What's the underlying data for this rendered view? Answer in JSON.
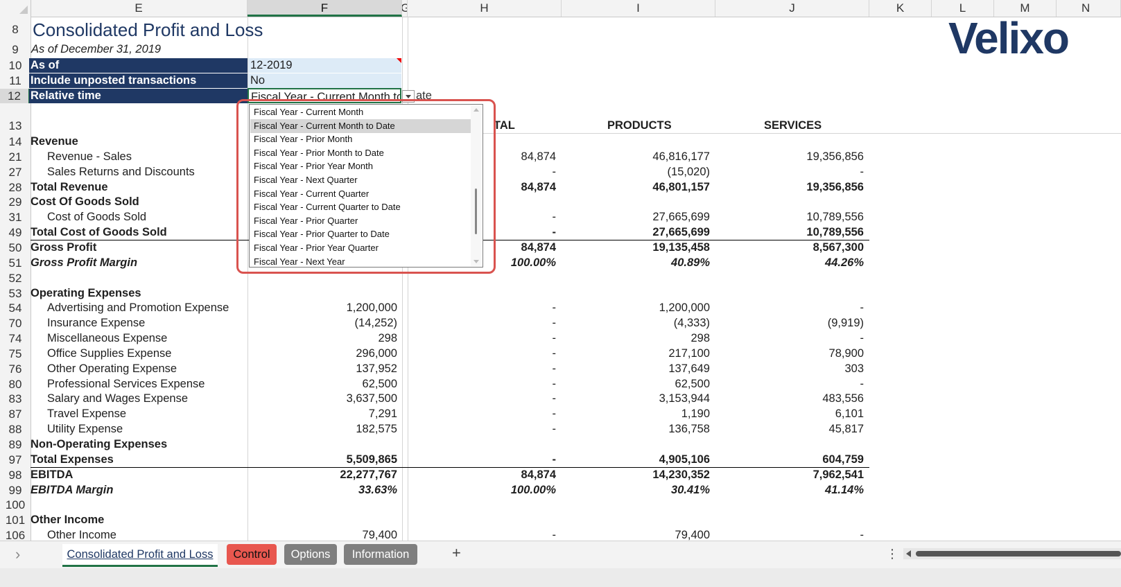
{
  "columns": [
    "E",
    "F",
    "G",
    "H",
    "I",
    "J",
    "K",
    "L",
    "M",
    "N"
  ],
  "report": {
    "title": "Consolidated Profit and Loss",
    "subtitle": "As of December 31, 2019"
  },
  "params": [
    {
      "row": "10",
      "label": "As of",
      "value": "12-2019"
    },
    {
      "row": "11",
      "label": "Include unposted transactions",
      "value": "No"
    },
    {
      "row": "12",
      "label": "Relative time",
      "value": "Fiscal Year - Current Month to Date"
    }
  ],
  "param_overflow": "ate",
  "logo": "Velixo",
  "headers": {
    "row": "13",
    "h": "TAL",
    "i": "PRODUCTS",
    "j": "SERVICES"
  },
  "rows": [
    {
      "n": "14",
      "label": "Revenue",
      "style": "b",
      "indent": false,
      "f": "",
      "h": "",
      "i": "",
      "j": ""
    },
    {
      "n": "21",
      "label": "Revenue - Sales",
      "style": "",
      "indent": true,
      "f": "",
      "h": "84,874",
      "i": "46,816,177",
      "j": "19,356,856"
    },
    {
      "n": "27",
      "label": "Sales Returns and Discounts",
      "style": "",
      "indent": true,
      "f": "",
      "h": "-",
      "i": "(15,020)",
      "j": "-"
    },
    {
      "n": "28",
      "label": "Total Revenue",
      "style": "b",
      "indent": false,
      "f": "",
      "h": "84,874",
      "i": "46,801,157",
      "j": "19,356,856"
    },
    {
      "n": "29",
      "label": "Cost Of Goods Sold",
      "style": "b",
      "indent": false,
      "f": "",
      "h": "",
      "i": "",
      "j": ""
    },
    {
      "n": "31",
      "label": "Cost of Goods Sold",
      "style": "",
      "indent": true,
      "f": "",
      "h": "-",
      "i": "27,665,699",
      "j": "10,789,556"
    },
    {
      "n": "49",
      "label": "Total Cost of Goods Sold",
      "style": "b",
      "indent": false,
      "f": "",
      "h": "-",
      "i": "27,665,699",
      "j": "10,789,556"
    },
    {
      "n": "50",
      "label": "Gross Profit",
      "style": "b",
      "indent": false,
      "f": "",
      "h": "84,874",
      "i": "19,135,458",
      "j": "8,567,300"
    },
    {
      "n": "51",
      "label": "Gross Profit Margin",
      "style": "bi",
      "indent": false,
      "f": "",
      "h": "100.00%",
      "i": "40.89%",
      "j": "44.26%"
    },
    {
      "n": "52",
      "label": "",
      "style": "",
      "indent": false,
      "f": "",
      "h": "",
      "i": "",
      "j": ""
    },
    {
      "n": "53",
      "label": "Operating Expenses",
      "style": "b",
      "indent": false,
      "f": "",
      "h": "",
      "i": "",
      "j": ""
    },
    {
      "n": "54",
      "label": "Advertising and Promotion Expense",
      "style": "",
      "indent": true,
      "f": "1,200,000",
      "h": "-",
      "i": "1,200,000",
      "j": "-"
    },
    {
      "n": "70",
      "label": "Insurance Expense",
      "style": "",
      "indent": true,
      "f": "(14,252)",
      "h": "-",
      "i": "(4,333)",
      "j": "(9,919)"
    },
    {
      "n": "74",
      "label": "Miscellaneous Expense",
      "style": "",
      "indent": true,
      "f": "298",
      "h": "-",
      "i": "298",
      "j": "-"
    },
    {
      "n": "75",
      "label": "Office Supplies Expense",
      "style": "",
      "indent": true,
      "f": "296,000",
      "h": "-",
      "i": "217,100",
      "j": "78,900"
    },
    {
      "n": "76",
      "label": "Other Operating Expense",
      "style": "",
      "indent": true,
      "f": "137,952",
      "h": "-",
      "i": "137,649",
      "j": "303"
    },
    {
      "n": "80",
      "label": "Professional Services Expense",
      "style": "",
      "indent": true,
      "f": "62,500",
      "h": "-",
      "i": "62,500",
      "j": "-"
    },
    {
      "n": "83",
      "label": "Salary and Wages Expense",
      "style": "",
      "indent": true,
      "f": "3,637,500",
      "h": "-",
      "i": "3,153,944",
      "j": "483,556"
    },
    {
      "n": "87",
      "label": "Travel Expense",
      "style": "",
      "indent": true,
      "f": "7,291",
      "h": "-",
      "i": "1,190",
      "j": "6,101"
    },
    {
      "n": "88",
      "label": "Utility Expense",
      "style": "",
      "indent": true,
      "f": "182,575",
      "h": "-",
      "i": "136,758",
      "j": "45,817"
    },
    {
      "n": "89",
      "label": "Non-Operating Expenses",
      "style": "b",
      "indent": false,
      "f": "",
      "h": "",
      "i": "",
      "j": ""
    },
    {
      "n": "97",
      "label": "Total Expenses",
      "style": "b",
      "indent": false,
      "f": "5,509,865",
      "h": "-",
      "i": "4,905,106",
      "j": "604,759"
    },
    {
      "n": "98",
      "label": "EBITDA",
      "style": "b",
      "indent": false,
      "f": "22,277,767",
      "h": "84,874",
      "i": "14,230,352",
      "j": "7,962,541"
    },
    {
      "n": "99",
      "label": "EBITDA Margin",
      "style": "bi",
      "indent": false,
      "f": "33.63%",
      "h": "100.00%",
      "i": "30.41%",
      "j": "41.14%"
    },
    {
      "n": "100",
      "label": "",
      "style": "",
      "indent": false,
      "f": "",
      "h": "",
      "i": "",
      "j": ""
    },
    {
      "n": "101",
      "label": "Other Income",
      "style": "b",
      "indent": false,
      "f": "",
      "h": "",
      "i": "",
      "j": ""
    },
    {
      "n": "106",
      "label": "Other Income",
      "style": "",
      "indent": true,
      "f": "79,400",
      "h": "-",
      "i": "79,400",
      "j": "-"
    }
  ],
  "dropdown_options": [
    "Fiscal Year - Current Month",
    "Fiscal Year - Current Month to Date",
    "Fiscal Year - Prior Month",
    "Fiscal Year - Prior Month to Date",
    "Fiscal Year - Prior Year Month",
    "Fiscal Year - Next Quarter",
    "Fiscal Year - Current Quarter",
    "Fiscal Year - Current Quarter to Date",
    "Fiscal Year - Prior Quarter",
    "Fiscal Year - Prior Quarter to Date",
    "Fiscal Year - Prior Year Quarter",
    "Fiscal Year - Next Year"
  ],
  "dropdown_selected_index": 1,
  "sheet_tabs": {
    "prev": "›",
    "tabs": [
      "Consolidated Profit and Loss",
      "Control",
      "Options",
      "Information"
    ],
    "add": "+",
    "more": "⋮"
  },
  "colors": {
    "navy": "#1f3864",
    "input": "#ddebf7",
    "accent": "#217346",
    "highlight": "#d9534f",
    "control_tab": "#e8574f",
    "grey_tab": "#7f7f7f"
  }
}
